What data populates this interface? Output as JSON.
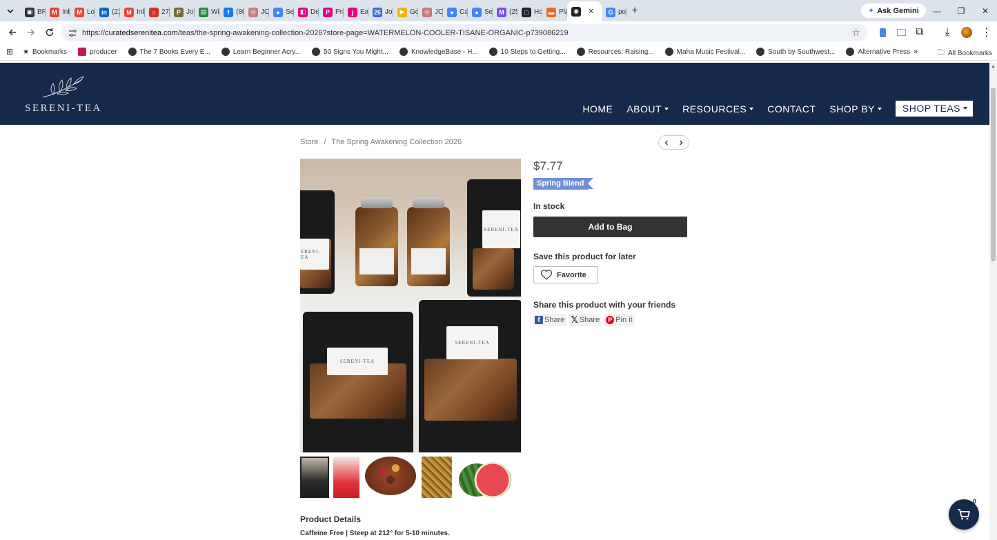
{
  "browser": {
    "tabs": [
      {
        "label": "BR",
        "fav_color": "#333333",
        "fav_glyph": "▣"
      },
      {
        "label": "Inb",
        "fav_color": "#ea4335",
        "fav_glyph": "M"
      },
      {
        "label": "Lo",
        "fav_color": "#ea4335",
        "fav_glyph": "M"
      },
      {
        "label": "(21",
        "fav_color": "#0a66c2",
        "fav_glyph": "in"
      },
      {
        "label": "Inb",
        "fav_color": "#ea4335",
        "fav_glyph": "M"
      },
      {
        "label": "273",
        "fav_color": "#d93025",
        "fav_glyph": "⌂"
      },
      {
        "label": "Jot",
        "fav_color": "#7a6a3a",
        "fav_glyph": "P"
      },
      {
        "label": "Wi",
        "fav_color": "#1e8e3e",
        "fav_glyph": "▤"
      },
      {
        "label": "(80",
        "fav_color": "#1877f2",
        "fav_glyph": "f"
      },
      {
        "label": "JO",
        "fav_color": "#c77",
        "fav_glyph": "◎"
      },
      {
        "label": "Sel",
        "fav_color": "#4285f4",
        "fav_glyph": "●"
      },
      {
        "label": "De",
        "fav_color": "#e6007e",
        "fav_glyph": "◧"
      },
      {
        "label": "Pri",
        "fav_color": "#e6007e",
        "fav_glyph": "P"
      },
      {
        "label": "Eas",
        "fav_color": "#e6007e",
        "fav_glyph": "j"
      },
      {
        "label": "Jot",
        "fav_color": "#3b6bd6",
        "fav_glyph": "26"
      },
      {
        "label": "Go",
        "fav_color": "#f4b400",
        "fav_glyph": "▶"
      },
      {
        "label": "JO",
        "fav_color": "#c77",
        "fav_glyph": "◎"
      },
      {
        "label": "Ca",
        "fav_color": "#4285f4",
        "fav_glyph": "●"
      },
      {
        "label": "Sel",
        "fav_color": "#4285f4",
        "fav_glyph": "●"
      },
      {
        "label": "(25",
        "fav_color": "#7b4de0",
        "fav_glyph": "M"
      },
      {
        "label": "Ho",
        "fav_color": "#222222",
        "fav_glyph": "□"
      },
      {
        "label": "Pla",
        "fav_color": "#f06a1d",
        "fav_glyph": "▬"
      },
      {
        "label": "",
        "fav_color": "#222222",
        "fav_glyph": "◉",
        "active": true
      },
      {
        "label": "po",
        "fav_color": "#4285f4",
        "fav_glyph": "G"
      }
    ],
    "new_tab_glyph": "+",
    "ask_gemini": "Ask Gemini",
    "url_prefix": "https://",
    "url_host": "curatedserenitea.com",
    "url_path": "/teas/the-spring-awakening-collection-2026?store-page=WATERMELON-COOLER-TISANE-ORGANIC-p739086219",
    "bookmarks_label": "Bookmarks",
    "bookmarks": [
      "producer",
      "The 7 Books Every E...",
      "Learn Beginner Acry...",
      "50 Signs You Might...",
      "KnowledgeBase - H...",
      "10 Steps to Getting...",
      "Resources: Raising...",
      "Maha Music Festival...",
      "South by Southwest...",
      "Alternative Press"
    ],
    "all_bookmarks": "All Bookmarks"
  },
  "site": {
    "logo_text": "SERENI-TEA",
    "nav": [
      {
        "label": "HOME",
        "dropdown": false
      },
      {
        "label": "ABOUT",
        "dropdown": true
      },
      {
        "label": "RESOURCES",
        "dropdown": true
      },
      {
        "label": "CONTACT",
        "dropdown": false
      },
      {
        "label": "SHOP BY",
        "dropdown": true
      },
      {
        "label": "SHOP TEAS",
        "dropdown": true
      }
    ],
    "header_color": "#152a4a"
  },
  "breadcrumb": {
    "store": "Store",
    "separator": "/",
    "collection": "The Spring Awakening Collection 2026"
  },
  "product": {
    "price": "$7.77",
    "tag": "Spring Blend",
    "tag_color": "#6f8fd6",
    "stock": "In stock",
    "add_to_bag": "Add to Bag",
    "save_label": "Save this product for later",
    "favorite": "Favorite",
    "share_label": "Share this product with your friends",
    "shares": [
      {
        "label": "Share",
        "icon": "facebook-icon"
      },
      {
        "label": "Share",
        "icon": "x-icon"
      },
      {
        "label": "Pin it",
        "icon": "pinterest-icon"
      }
    ],
    "bag_label": "SERENI-TEA"
  },
  "details": {
    "heading": "Product Details",
    "subtitle": "Caffeine Free | Steep at 212° for 5-10 minutes."
  },
  "cart": {
    "count": "0"
  }
}
